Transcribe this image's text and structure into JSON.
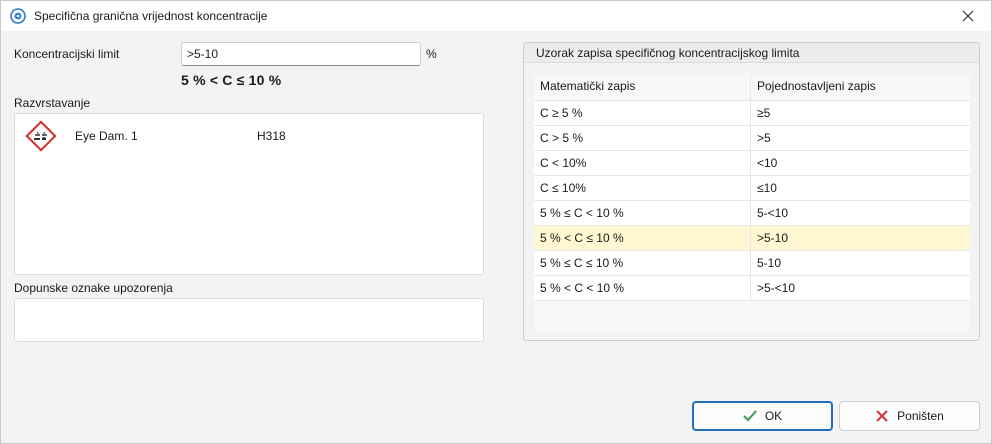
{
  "window": {
    "title": "Specifična granična vrijednost koncentracije",
    "close_icon": "close-icon"
  },
  "form": {
    "limit_label": "Koncentracijski limit",
    "limit_value": ">5-10",
    "unit": "%",
    "formula": "5 % < C ≤ 10 %",
    "classification_label": "Razvrstavanje",
    "classifications": [
      {
        "icon": "ghs05-corrosion-icon",
        "name": "Eye Dam. 1",
        "code": "H318"
      }
    ],
    "supplementary_label": "Dopunske oznake upozorenja",
    "supplementary_value": ""
  },
  "samples": {
    "title": "Uzorak zapisa specifičnog koncentracijskog limita",
    "columns": [
      "Matematički zapis",
      "Pojednostavljeni zapis"
    ],
    "rows": [
      [
        "C ≥ 5 %",
        "≥5"
      ],
      [
        "C > 5 %",
        ">5"
      ],
      [
        "C < 10%",
        "<10"
      ],
      [
        "C ≤ 10%",
        "≤10"
      ],
      [
        "5 % ≤ C < 10 %",
        "5-<10"
      ],
      [
        "5 % < C ≤ 10 %",
        ">5-10"
      ],
      [
        "5 % ≤ C ≤ 10 %",
        "5-10"
      ],
      [
        "5 % < C < 10 %",
        ">5-<10"
      ]
    ],
    "highlight_color": "#fff8d2"
  },
  "buttons": {
    "ok_label": "OK",
    "ok_icon": "check-icon",
    "cancel_label": "Poništen",
    "cancel_icon": "x-icon"
  },
  "colors": {
    "accent": "#1f6fbf",
    "check": "#3a9b54",
    "cancel": "#d43b3b",
    "hazard": "#d52b2b"
  }
}
